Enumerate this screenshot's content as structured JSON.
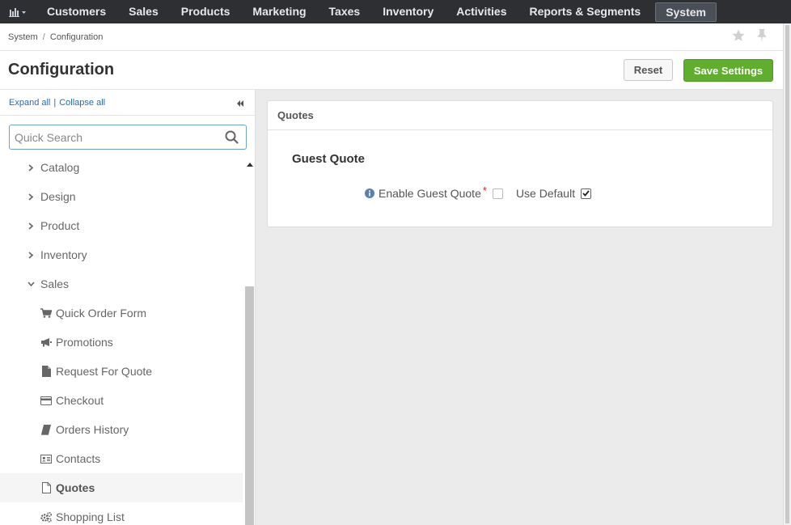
{
  "nav": {
    "items": [
      {
        "label": "Customers"
      },
      {
        "label": "Sales"
      },
      {
        "label": "Products"
      },
      {
        "label": "Marketing"
      },
      {
        "label": "Taxes"
      },
      {
        "label": "Inventory"
      },
      {
        "label": "Activities"
      },
      {
        "label": "Reports & Segments"
      },
      {
        "label": "System",
        "active": true
      }
    ]
  },
  "breadcrumb": {
    "parent": "System",
    "separator": "/",
    "current": "Configuration"
  },
  "header": {
    "title": "Configuration",
    "reset_label": "Reset",
    "save_label": "Save Settings"
  },
  "sidebar": {
    "expand_all": "Expand all",
    "collapse_all": "Collapse all",
    "search_placeholder": "Quick Search",
    "items": [
      {
        "label": "Catalog",
        "type": "parent"
      },
      {
        "label": "Design",
        "type": "parent"
      },
      {
        "label": "Product",
        "type": "parent"
      },
      {
        "label": "Inventory",
        "type": "parent"
      },
      {
        "label": "Sales",
        "type": "parent-open"
      },
      {
        "label": "Quick Order Form",
        "icon": "cart-icon"
      },
      {
        "label": "Promotions",
        "icon": "megaphone-icon"
      },
      {
        "label": "Request For Quote",
        "icon": "file-icon"
      },
      {
        "label": "Checkout",
        "icon": "credit-card-icon"
      },
      {
        "label": "Orders History",
        "icon": "book-icon"
      },
      {
        "label": "Contacts",
        "icon": "contact-card-icon"
      },
      {
        "label": "Quotes",
        "icon": "file-outline-icon",
        "selected": true
      },
      {
        "label": "Shopping List",
        "icon": "cogs-icon"
      }
    ]
  },
  "content": {
    "panel_title": "Quotes",
    "section_title": "Guest Quote",
    "field_label": "Enable Guest Quote",
    "required_mark": "*",
    "field_checked": false,
    "use_default_label": "Use Default",
    "use_default_checked": true
  },
  "colors": {
    "nav_bg": "#2d2f33",
    "save_green": "#5fae2e",
    "link_blue": "#2a6aa8",
    "required_red": "#c81e1e"
  }
}
